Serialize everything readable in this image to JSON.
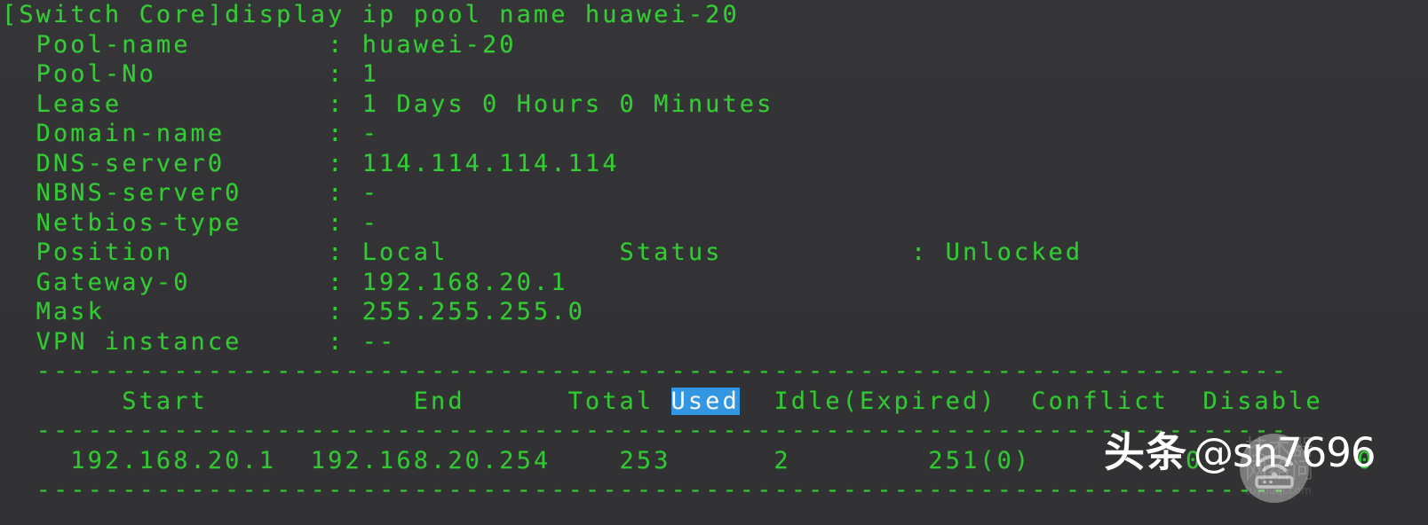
{
  "terminal": {
    "background_color": "#333336",
    "text_color": "#33cc33",
    "selection_bg_color": "#3399e6",
    "selection_fg_color": "#ffffff",
    "prompt_line": "[Switch Core]display ip pool name huawei-20",
    "prompt": "[Switch Core]",
    "command": "display ip pool name huawei-20"
  },
  "pool": {
    "fields": [
      {
        "label": "Pool-name",
        "sep": ":",
        "value": "huawei-20"
      },
      {
        "label": "Pool-No",
        "sep": ":",
        "value": "1"
      },
      {
        "label": "Lease",
        "sep": ":",
        "value": "1 Days 0 Hours 0 Minutes"
      },
      {
        "label": "Domain-name",
        "sep": ":",
        "value": "-"
      },
      {
        "label": "DNS-server0",
        "sep": ":",
        "value": "114.114.114.114"
      },
      {
        "label": "NBNS-server0",
        "sep": ":",
        "value": "-"
      },
      {
        "label": "Netbios-type",
        "sep": ":",
        "value": "-"
      },
      {
        "label": "Position",
        "sep": ":",
        "value": "Local"
      },
      {
        "label": "Gateway-0",
        "sep": ":",
        "value": "192.168.20.1"
      },
      {
        "label": "Mask",
        "sep": ":",
        "value": "255.255.255.0"
      },
      {
        "label": "VPN instance",
        "sep": ":",
        "value": "--"
      }
    ],
    "status_label": "Status",
    "status_sep": ":",
    "status_value": "Unlocked"
  },
  "lines": {
    "l1": "[Switch Core]display ip pool name huawei-20",
    "l2": "  Pool-name        : huawei-20",
    "l3": "  Pool-No          : 1",
    "l4": "  Lease            : 1 Days 0 Hours 0 Minutes",
    "l5": "  Domain-name      : -",
    "l6": "  DNS-server0      : 114.114.114.114",
    "l7": "  NBNS-server0     : -",
    "l8": "  Netbios-type     : -",
    "l9": "  Position         : Local          Status           : Unlocked",
    "l10": "  Gateway-0        : 192.168.20.1",
    "l11": "  Mask             : 255.255.255.0",
    "l12": "  VPN instance     : --",
    "rule_top": "  -------------------------------------------------------------------------",
    "header_pre": "       Start            End      Total ",
    "header_sel": "Used",
    "header_post": "  Idle(Expired)  Conflict  Disable",
    "rule_mid": "  -------------------------------------------------------------------------",
    "data_row": "    192.168.20.1  192.168.20.254    253      2        251(0)         0         0",
    "rule_bottom": "  -------------------------------------------------------------------------"
  },
  "table": {
    "headers": [
      "Start",
      "End",
      "Total",
      "Used",
      "Idle(Expired)",
      "Conflict",
      "Disable"
    ],
    "selected_header": "Used",
    "rows": [
      {
        "start": "192.168.20.1",
        "end": "192.168.20.254",
        "total": "253",
        "used": "2",
        "idle_expired": "251(0)",
        "conflict": "0",
        "disable": "0"
      }
    ]
  },
  "watermark": {
    "brand": "头条",
    "handle": "@sn7696",
    "logo_icon": "wifi-router-icon",
    "ghost_text": "技术器\n网络问",
    "ghost_small": "tuyouqi.com"
  }
}
